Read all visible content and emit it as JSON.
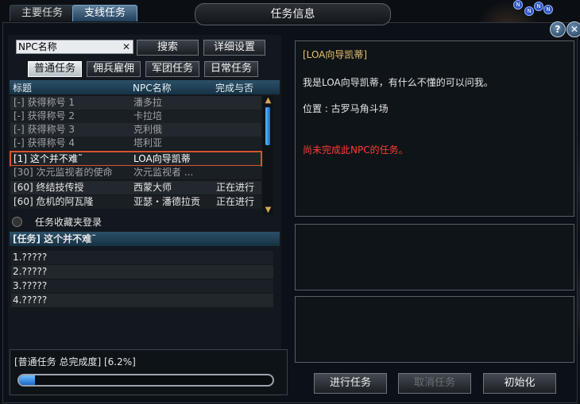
{
  "tabs": [
    {
      "label": "主要任务",
      "active": false
    },
    {
      "label": "支线任务",
      "active": true
    }
  ],
  "window": {
    "title": "任务信息"
  },
  "corner_buttons": {
    "help": "?",
    "close": "✕"
  },
  "search": {
    "value": "NPC名称",
    "search_button": "搜索",
    "detail_button": "详细设置"
  },
  "filter_tabs": [
    "普通任务",
    "佣兵雇佣",
    "军团任务",
    "日常任务"
  ],
  "columns": {
    "title": "标题",
    "npc": "NPC名称",
    "status": "完成与否"
  },
  "quests": [
    {
      "title": "[-] 获得称号 1",
      "npc": "潘多拉",
      "status": ""
    },
    {
      "title": "[-] 获得称号 2",
      "npc": "卡拉培",
      "status": ""
    },
    {
      "title": "[-] 获得称号 3",
      "npc": "克利俄",
      "status": ""
    },
    {
      "title": "[-] 获得称号 4",
      "npc": "塔利亚",
      "status": ""
    },
    {
      "title": "[1] 这个并不难˜",
      "npc": "LOA向导凯蒂",
      "status": ""
    },
    {
      "title": "[30] 次元监视者的使命",
      "npc": "次元监视者 ...",
      "status": ""
    },
    {
      "title": "[60] 终结技传授",
      "npc": "西蒙大师",
      "status": "正在进行"
    },
    {
      "title": "[60] 危机的阿瓦隆",
      "npc": "亚瑟・潘德拉贡",
      "status": "正在进行"
    }
  ],
  "favorites_label": "任务收藏夹登录",
  "selected_quest": {
    "header": "[任务] 这个并不难˜",
    "objectives": [
      "1.?????",
      "2.?????",
      "3.?????",
      "4.?????"
    ]
  },
  "progress": {
    "label": "[普通任务 总完成度] [6.2%]",
    "value_percent": 6.2
  },
  "npc_info": {
    "name": "[LOA向导凯蒂]",
    "greeting": "我是LOA向导凯蒂，有什么不懂的可以问我。",
    "location": "位置 : 古罗马角斗场",
    "warning": "尚未完成此NPC的任务。"
  },
  "actions": {
    "start": "进行任务",
    "cancel": "取消任务",
    "reset": "初始化"
  },
  "colors": {
    "accent": "#1a66c8",
    "npc_name": "#e8c26a",
    "warning": "#ff3b30",
    "selection": "#d8542f"
  }
}
